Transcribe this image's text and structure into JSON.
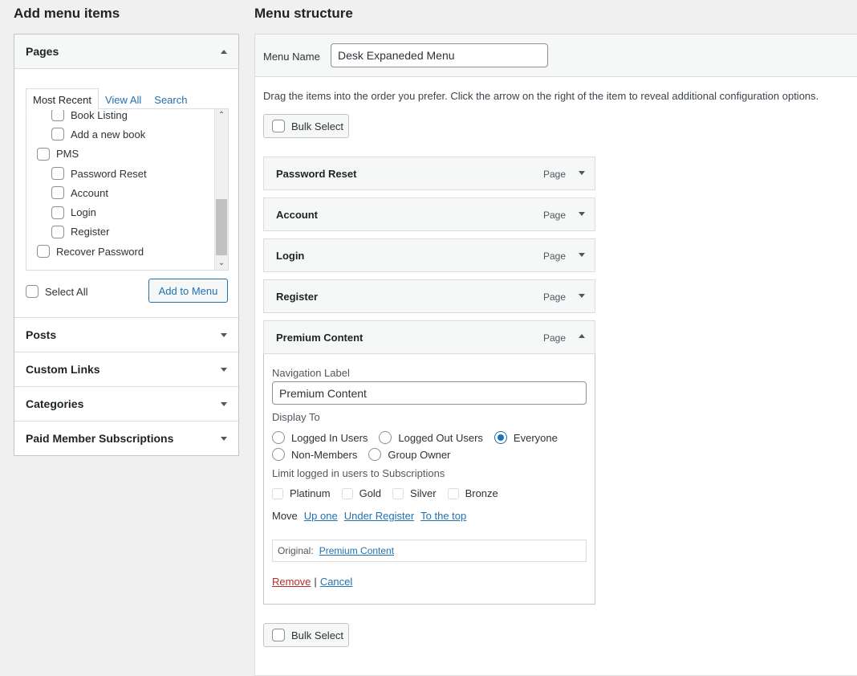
{
  "left": {
    "heading": "Add menu items",
    "pages": {
      "title": "Pages",
      "tabs": [
        "Most Recent",
        "View All",
        "Search"
      ],
      "items": [
        {
          "label": "Book Listing",
          "indent": 1
        },
        {
          "label": "Add a new book",
          "indent": 1
        },
        {
          "label": "PMS",
          "indent": 0
        },
        {
          "label": "Password Reset",
          "indent": 1
        },
        {
          "label": "Account",
          "indent": 1
        },
        {
          "label": "Login",
          "indent": 1
        },
        {
          "label": "Register",
          "indent": 1
        },
        {
          "label": "Recover Password",
          "indent": 0
        }
      ],
      "select_all": "Select All",
      "add_button": "Add to Menu"
    },
    "sections": [
      "Posts",
      "Custom Links",
      "Categories",
      "Paid Member Subscriptions"
    ]
  },
  "right": {
    "heading": "Menu structure",
    "menu_name_label": "Menu Name",
    "menu_name_value": "Desk Expaneded Menu",
    "instructions": "Drag the items into the order you prefer. Click the arrow on the right of the item to reveal additional configuration options.",
    "bulk_select": "Bulk Select",
    "items": [
      {
        "title": "Password Reset",
        "type": "Page"
      },
      {
        "title": "Account",
        "type": "Page"
      },
      {
        "title": "Login",
        "type": "Page"
      },
      {
        "title": "Register",
        "type": "Page"
      },
      {
        "title": "Premium Content",
        "type": "Page"
      }
    ],
    "settings": {
      "nav_label_title": "Navigation Label",
      "nav_label_value": "Premium Content",
      "display_to_title": "Display To",
      "display_options": [
        "Logged In Users",
        "Logged Out Users",
        "Everyone",
        "Non-Members",
        "Group Owner"
      ],
      "display_selected": "Everyone",
      "limit_title": "Limit logged in users to Subscriptions",
      "subscriptions": [
        "Platinum",
        "Gold",
        "Silver",
        "Bronze"
      ],
      "move_label": "Move",
      "move_links": [
        "Up one",
        "Under Register",
        "To the top"
      ],
      "original_label": "Original:",
      "original_link": "Premium Content",
      "remove": "Remove",
      "separator": "|",
      "cancel": "Cancel"
    }
  },
  "colors": {
    "accent": "#2271b1",
    "danger": "#b32d2e",
    "background": "#f0f0f1"
  }
}
